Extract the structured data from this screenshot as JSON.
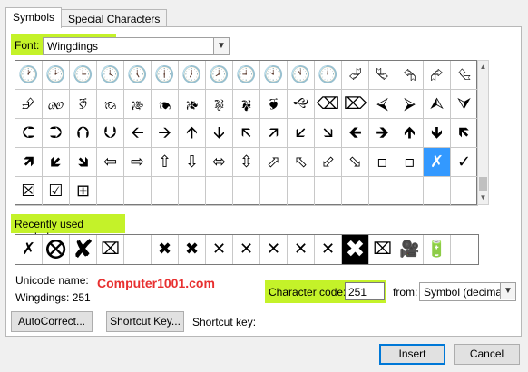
{
  "tabs": [
    {
      "label": "Symbols",
      "accel": "S",
      "active": true
    },
    {
      "label": "Special Characters",
      "accel": "P",
      "active": false
    }
  ],
  "font": {
    "label": "Font:",
    "accel": "F",
    "value": "Wingdings"
  },
  "symbol_grid": {
    "rows": [
      [
        "🕐",
        "🕑",
        "🕒",
        "🕓",
        "🕔",
        "🕕",
        "🕖",
        "🕗",
        "🕘",
        "🕙",
        "🕚",
        "🕛",
        "⮰",
        "⮱",
        "⮲",
        "⮳",
        "⮴"
      ],
      [
        "⮵",
        "🙐",
        "🙑",
        "🙒",
        "🙓",
        "🙔",
        "🙕",
        "🙖",
        "🙗",
        "🙘",
        "🙙",
        "⌫",
        "⌦",
        "⮘",
        "⮚",
        "⮙",
        "⮛"
      ],
      [
        "⮈",
        "⮊",
        "⮉",
        "⮋",
        "🡨",
        "🡪",
        "🡩",
        "🡫",
        "🡬",
        "🡭",
        "🡯",
        "🡮",
        "🡸",
        "🡺",
        "🡹",
        "🡻",
        "🡼"
      ],
      [
        "🡽",
        "🡿",
        "🡾",
        "⇦",
        "⇨",
        "⇧",
        "⇩",
        "⬄",
        "⇳",
        "⬀",
        "⬁",
        "⬃",
        "⬂",
        "▫",
        "▫",
        "✗",
        "✓"
      ],
      [
        "☒",
        "☑",
        "⊞",
        "",
        "",
        "",
        "",
        "",
        "",
        "",
        "",
        "",
        "",
        "",
        "",
        "",
        ""
      ]
    ],
    "selected": {
      "row": 3,
      "col": 15
    }
  },
  "recent": {
    "label": "Recently used symbols:",
    "accel": "R",
    "symbols": [
      "✗",
      "⮾",
      "✘",
      "⌧",
      "",
      "✖",
      "✖",
      "✕",
      "✕",
      "✕",
      "✕",
      "✕",
      "✖",
      "⌧",
      "🎥",
      "🔋"
    ]
  },
  "unicode_name_label": "Unicode name:",
  "site_watermark": "Computer1001.com",
  "char_name": "Wingdings: 251",
  "character_code": {
    "label": "Character code:",
    "value": "251"
  },
  "from": {
    "label": "from:",
    "accel": "M",
    "value": "Symbol (decimal)"
  },
  "buttons": {
    "autocorrect": "AutoCorrect...",
    "shortcut_key": "Shortcut Key...",
    "insert": "Insert",
    "cancel": "Cancel"
  },
  "shortcut_key_text": "Shortcut key:"
}
